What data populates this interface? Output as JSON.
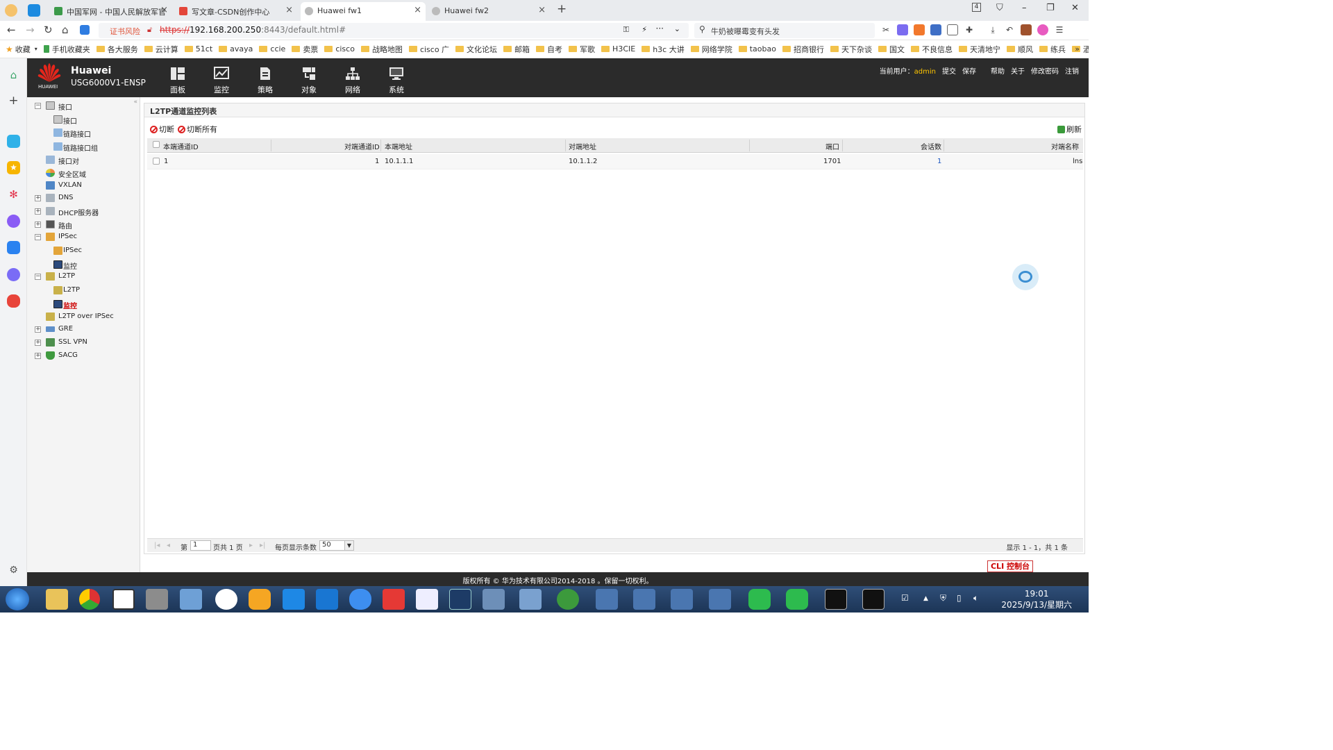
{
  "browser": {
    "tabs": [
      {
        "title": "中国军网 - 中国人民解放军官",
        "active": false
      },
      {
        "title": "写文章-CSDN创作中心",
        "active": false
      },
      {
        "title": "Huawei fw1",
        "active": true
      },
      {
        "title": "Huawei fw2",
        "active": false
      }
    ],
    "tab_counter": "4",
    "risk_label": "证书风险",
    "url_scheme": "https://",
    "url_host": "192.168.200.250",
    "url_rest": ":8443/default.html#",
    "search_text": "牛奶被曝霉变有头发",
    "bookmarks": [
      "收藏",
      "手机收藏夹",
      "各大服务",
      "云计算",
      "51ct",
      "avaya",
      "ccie",
      "卖票",
      "cisco",
      "战略地图",
      "cisco 广",
      "文化论坛",
      "邮箱",
      "自考",
      "军歌",
      "H3CIE",
      "h3c 大讲",
      "网络学院",
      "taobao",
      "招商银行",
      "天下杂谈",
      "国文",
      "不良信息",
      "天清地宁",
      "顺风",
      "练兵",
      "酒店预订"
    ]
  },
  "app": {
    "brand": "Huawei",
    "model": "USG6000V1-ENSP",
    "logo_text": "HUAWEI",
    "nav": [
      {
        "label": "面板",
        "icon": "dashboard-icon"
      },
      {
        "label": "监控",
        "icon": "monitor-icon"
      },
      {
        "label": "策略",
        "icon": "policy-icon"
      },
      {
        "label": "对象",
        "icon": "object-icon"
      },
      {
        "label": "网络",
        "icon": "network-icon"
      },
      {
        "label": "系统",
        "icon": "system-icon"
      }
    ],
    "topright": {
      "user_label": "当前用户：",
      "username": "admin",
      "links": [
        "提交",
        "保存",
        "帮助",
        "关于",
        "修改密码",
        "注销"
      ]
    },
    "footer": "版权所有 © 华为技术有限公司2014-2018 。保留一切权利。",
    "cli_button": "CLI 控制台"
  },
  "tree": [
    {
      "label": "接口",
      "level": 0,
      "toggle": "minus"
    },
    {
      "label": "接口",
      "level": 1
    },
    {
      "label": "链路接口",
      "level": 1
    },
    {
      "label": "链路接口组",
      "level": 1
    },
    {
      "label": "接口对",
      "level": 0
    },
    {
      "label": "安全区域",
      "level": 0
    },
    {
      "label": "VXLAN",
      "level": 0
    },
    {
      "label": "DNS",
      "level": 0,
      "toggle": "plus"
    },
    {
      "label": "DHCP服务器",
      "level": 0,
      "toggle": "plus"
    },
    {
      "label": "路由",
      "level": 0,
      "toggle": "plus"
    },
    {
      "label": "IPSec",
      "level": 0,
      "toggle": "minus"
    },
    {
      "label": "IPSec",
      "level": 1
    },
    {
      "label": "监控",
      "level": 1
    },
    {
      "label": "L2TP",
      "level": 0,
      "toggle": "minus"
    },
    {
      "label": "L2TP",
      "level": 1
    },
    {
      "label": "监控",
      "level": 1,
      "selected": true
    },
    {
      "label": "L2TP over IPSec",
      "level": 0
    },
    {
      "label": "GRE",
      "level": 0,
      "toggle": "plus"
    },
    {
      "label": "SSL VPN",
      "level": 0,
      "toggle": "plus"
    },
    {
      "label": "SACG",
      "level": 0,
      "toggle": "plus"
    }
  ],
  "panel": {
    "title": "L2TP通道监控列表",
    "actions": {
      "cut": "切断",
      "cut_all": "切断所有",
      "refresh": "刷新"
    },
    "columns": [
      "本端通道ID",
      "对端通道ID",
      "本端地址",
      "对端地址",
      "端口",
      "会话数",
      "对端名称"
    ],
    "rows": [
      {
        "local_id": "1",
        "peer_id": "1",
        "local_addr": "10.1.1.1",
        "peer_addr": "10.1.1.2",
        "port": "1701",
        "sessions": "1",
        "peer_name": "lns"
      }
    ],
    "pager": {
      "page_prefix": "第",
      "page_value": "1",
      "page_suffix": "页共 1 页",
      "per_page_label": "每页显示条数",
      "per_page_value": "50",
      "summary": "显示 1 - 1，共 1 条"
    }
  },
  "taskbar": {
    "time": "19:01",
    "date": "2025/9/13/星期六"
  }
}
